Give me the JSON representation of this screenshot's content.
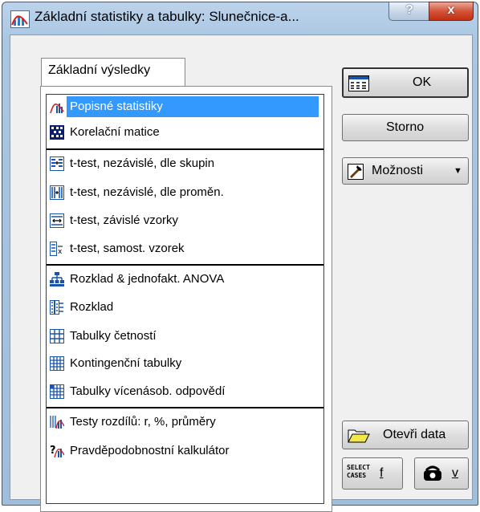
{
  "window": {
    "title": "Základní statistiky a tabulky: Slunečnice-a...",
    "help_glyph": "?",
    "close_glyph": "x"
  },
  "tab": {
    "label": "Základní výsledky"
  },
  "list": {
    "items": [
      {
        "label": "Popisné statistiky",
        "icon": "descriptive-stats-icon",
        "selected": true
      },
      {
        "label": "Korelační matice",
        "icon": "correlation-matrix-icon"
      },
      {
        "label": "t-test, nezávislé, dle skupin",
        "icon": "ttest-groups-icon"
      },
      {
        "label": "t-test, nezávislé, dle proměn.",
        "icon": "ttest-variables-icon"
      },
      {
        "label": "t-test, závislé vzorky",
        "icon": "ttest-dependent-icon"
      },
      {
        "label": "t-test, samost. vzorek",
        "icon": "ttest-single-icon"
      },
      {
        "label": "Rozklad & jednofakt. ANOVA",
        "icon": "anova-icon"
      },
      {
        "label": "Rozklad",
        "icon": "breakdown-icon"
      },
      {
        "label": "Tabulky četností",
        "icon": "frequency-table-icon"
      },
      {
        "label": "Kontingenční tabulky",
        "icon": "crosstab-icon"
      },
      {
        "label": "Tabulky vícenásob. odpovědí",
        "icon": "multiresponse-table-icon"
      },
      {
        "label": "Testy rozdílů: r, %, průměry",
        "icon": "difference-tests-icon"
      },
      {
        "label": "Pravděpodobnostní kalkulátor",
        "icon": "probability-calculator-icon"
      }
    ]
  },
  "buttons": {
    "ok": "OK",
    "cancel": "Storno",
    "options": "Možnosti",
    "open_data": "Otevři data",
    "select_cases_line1": "SELECT",
    "select_cases_line2": "CASES",
    "select_cases_key": "f",
    "weights_key": "v"
  },
  "colors": {
    "selection": "#3399ff",
    "title_bar": "#a9c6e2",
    "close_button": "#c9401f"
  }
}
